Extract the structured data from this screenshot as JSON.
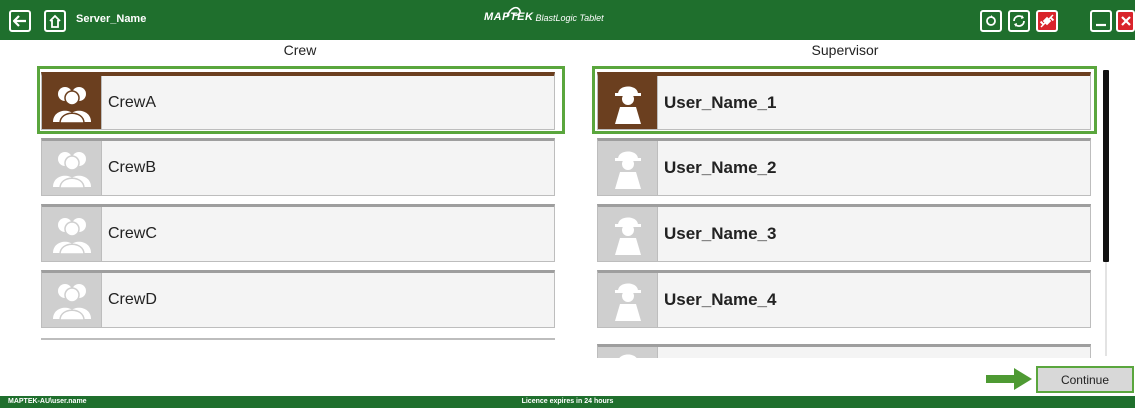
{
  "header": {
    "server_name": "Server_Name",
    "logo_brand": "MAPTEK",
    "logo_product": "BlastLogic Tablet",
    "background_color": "#1f6f2d"
  },
  "toolbar_icons": {
    "back": "back-arrow-icon",
    "home": "home-icon",
    "refresh": "refresh-icon",
    "sync": "sync-icon",
    "disconnected": "satellite-disconnected-icon",
    "minimize": "minimize-icon",
    "close": "close-icon"
  },
  "crew": {
    "title": "Crew",
    "items": [
      {
        "label": "CrewA",
        "selected": true
      },
      {
        "label": "CrewB",
        "selected": false
      },
      {
        "label": "CrewC",
        "selected": false
      },
      {
        "label": "CrewD",
        "selected": false
      }
    ]
  },
  "supervisor": {
    "title": "Supervisor",
    "items": [
      {
        "label": "User_Name_1",
        "selected": true
      },
      {
        "label": "User_Name_2",
        "selected": false
      },
      {
        "label": "User_Name_3",
        "selected": false
      },
      {
        "label": "User_Name_4",
        "selected": false
      }
    ]
  },
  "actions": {
    "continue_label": "Continue"
  },
  "footer": {
    "user": "MAPTEK-AU\\user.name",
    "licence": "Licence expires in 24 hours"
  },
  "colors": {
    "selected_avatar": "#6b3f1f",
    "selection_outline": "#5aa63d",
    "unselected_avatar": "#cfcfcf"
  }
}
